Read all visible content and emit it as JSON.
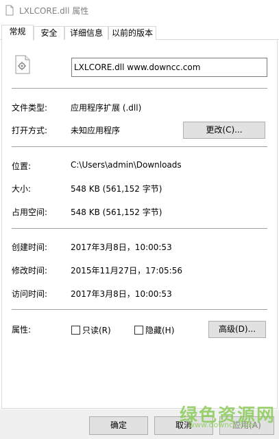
{
  "window": {
    "title": "LXLCORE.dll 属性"
  },
  "tabs": [
    {
      "label": "常规"
    },
    {
      "label": "安全"
    },
    {
      "label": "详细信息"
    },
    {
      "label": "以前的版本"
    }
  ],
  "general": {
    "file_name": "LXLCORE.dll  www.downcc.com",
    "file_type_label": "文件类型:",
    "file_type_value": "应用程序扩展 (.dll)",
    "open_with_label": "打开方式:",
    "open_with_value": "未知应用程序",
    "change_button": "更改(C)...",
    "location_label": "位置:",
    "location_value": "C:\\Users\\admin\\Downloads",
    "size_label": "大小:",
    "size_value": "548 KB (561,152 字节)",
    "size_on_disk_label": "占用空间:",
    "size_on_disk_value": "548 KB (561,152 字节)",
    "created_label": "创建时间:",
    "created_value": "2017年3月8日，10:00:53",
    "modified_label": "修改时间:",
    "modified_value": "2015年11月27日，17:05:56",
    "accessed_label": "访问时间:",
    "accessed_value": "2017年3月8日，10:00:53",
    "attributes_label": "属性:",
    "readonly_label": "只读(R)",
    "readonly_checked": false,
    "hidden_label": "隐藏(H)",
    "hidden_checked": false,
    "advanced_button": "高级(D)..."
  },
  "footer": {
    "ok_button": "确定",
    "cancel_button": "取消",
    "apply_button": "应用(A)"
  },
  "watermark": {
    "text": "绿色资源网",
    "sub": "www.downcc.com"
  }
}
